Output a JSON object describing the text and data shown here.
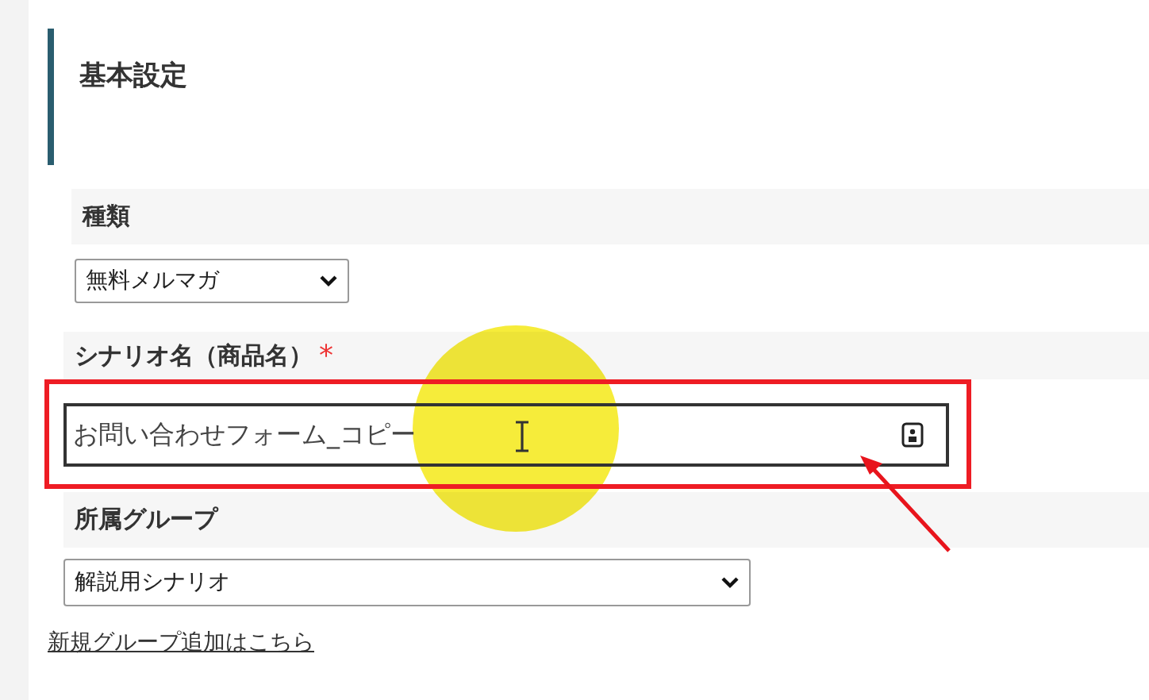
{
  "section": {
    "title": "基本設定"
  },
  "fields": [
    {
      "kind": "select",
      "label": "種類",
      "required": false,
      "value": "無料メルマガ"
    },
    {
      "kind": "text",
      "label": "シナリオ名（商品名）",
      "required": true,
      "value": "お問い合わせフォーム_コピー"
    },
    {
      "kind": "select",
      "label": "所属グループ",
      "required": false,
      "value": "解説用シナリオ",
      "link": "新規グループ追加はこちら"
    }
  ],
  "required_mark": "*"
}
